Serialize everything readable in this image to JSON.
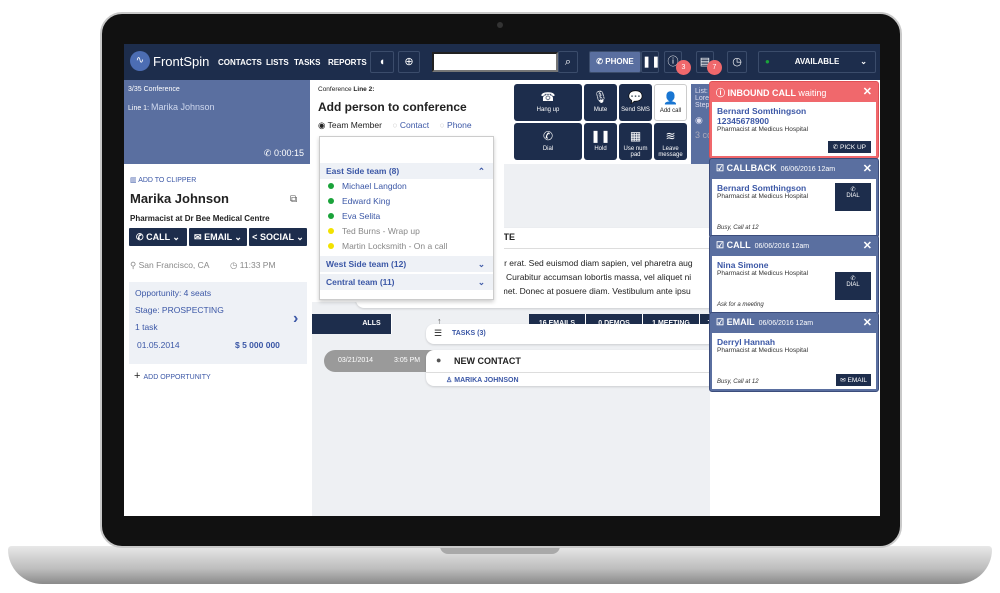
{
  "nav": {
    "brand": "FrontSpin",
    "links": [
      "CONTACTS",
      "LISTS",
      "TASKS",
      "REPORTS"
    ],
    "search_placeholder": "",
    "phone_label": "PHONE",
    "alert_count": "3",
    "tasks_count": "7",
    "status": "AVAILABLE"
  },
  "conference": {
    "count": "3/35 Conference",
    "line1_label": "Line 1:",
    "line1_name": "Marika Johnson",
    "timer": "0:00:15",
    "line2_label": "Conference",
    "line2_bold": "Line 2:",
    "title": "Add person to conference",
    "options": [
      "Team Member",
      "Contact",
      "Phone"
    ]
  },
  "dropdown": {
    "teams": [
      {
        "name": "East Side team (8)",
        "expanded": true
      },
      {
        "name": "West Side team (12)"
      },
      {
        "name": "Central team (11)"
      }
    ],
    "members": [
      {
        "name": "Michael Langdon",
        "status": "#1aa33a"
      },
      {
        "name": "Edward King",
        "status": "#1aa33a"
      },
      {
        "name": "Eva Selita",
        "status": "#1aa33a"
      },
      {
        "name": "Ted Burns - Wrap up",
        "status": "#f2e200"
      },
      {
        "name": "Martin Locksmith - On a call",
        "status": "#f2e200"
      }
    ]
  },
  "call_controls": [
    "Hang up",
    "Mute",
    "Send SMS",
    "Add call",
    "Dial",
    "Hold",
    "Use num pad",
    "Leave message"
  ],
  "contact": {
    "clipper": "ADD TO CLIPPER",
    "name": "Marika Johnson",
    "role": "Pharmacist at  Dr Bee Medical Centre",
    "actions": [
      "CALL",
      "EMAIL",
      "SOCIAL"
    ],
    "location": "San Francisco, CA",
    "time": "11:33 PM",
    "opportunity": {
      "seats": "Opportunity: 4 seats",
      "stage": "Stage: PROSPECTING",
      "tasks": "1 task",
      "date": "01.05.2014",
      "value": "$ 5 000 000"
    },
    "add_opportunity": "ADD OPPORTUNITY"
  },
  "stats": [
    "ALLS",
    "16 EMAILS",
    "0 DEMOS",
    "1 MEETING",
    "7"
  ],
  "timeline": {
    "note_title": "NOTE",
    "note_lines": [
      "u tortor erat. Sed euismod diam sapien, vel pharetra aug",
      "nd eu. Curabitur accumsan lobortis massa, vel aliquet ni",
      "r sit amet. Donec at posuere diam. Vestibulum ante ipsu"
    ],
    "tasks": "TASKS (3)",
    "date": "03/21/2014",
    "time": "3:05 PM",
    "event": "NEW CONTACT",
    "event_user": "MARIKA JOHNSON"
  },
  "list_panel": {
    "lines": [
      "List:",
      "Lore",
      "Step"
    ],
    "footer": "3 co"
  },
  "notifications": {
    "inbound": {
      "title": "INBOUND CALL",
      "suffix": "waiting",
      "name": "Bernard Somthingson",
      "phone": "12345678900",
      "role": "Pharmacist at Medicus Hospital",
      "action": "PICK UP",
      "color": "#f0686c"
    },
    "items": [
      {
        "type": "CALLBACK",
        "date": "06/06/2016 12am",
        "name": "Bernard Somthingson",
        "role": "Pharmacist at Medicus Hospital",
        "note": "Busy, Call at 12",
        "action": "DIAL"
      },
      {
        "type": "CALL",
        "date": "06/06/2016 12am",
        "name": "Nina Simone",
        "role": "Pharmacist at Medicus Hospital",
        "note": "Ask for a meeting",
        "action": "DIAL"
      },
      {
        "type": "EMAIL",
        "date": "06/06/2016 12am",
        "name": "Derryl Hannah",
        "role": "Pharmacist at Medicus Hospital",
        "note": "Busy, Call at 12",
        "action": "EMAIL"
      }
    ]
  }
}
